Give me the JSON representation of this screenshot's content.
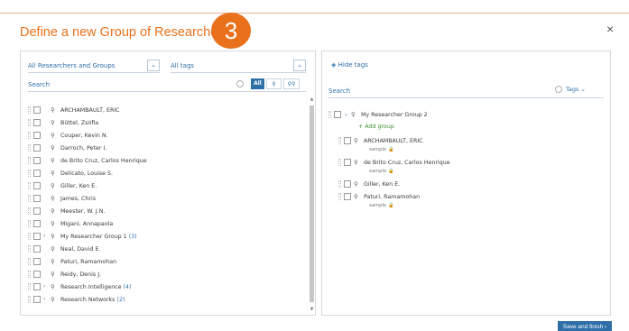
{
  "dialog": {
    "title": "Define a new Group of Researchers",
    "step_number": "3",
    "close_label": "×",
    "save_label": "Save and finish ›"
  },
  "left_panel": {
    "filter_dropdown": "All Researchers and Groups",
    "tags_dropdown": "All tags",
    "dropdown_arrow": "⌄",
    "search_placeholder": "Search",
    "segment_all": "All",
    "segment_person": "⚲",
    "segment_group": "⚲⚲",
    "rows": [
      {
        "label": "ARCHAMBAULT, ERIC",
        "expand": "",
        "count": ""
      },
      {
        "label": "Büttel, Zsófia",
        "expand": "",
        "count": ""
      },
      {
        "label": "Couper, Kevin N.",
        "expand": "",
        "count": ""
      },
      {
        "label": "Darroch, Peter I.",
        "expand": "",
        "count": ""
      },
      {
        "label": "de Brito Cruz, Carlos Henrique",
        "expand": "",
        "count": ""
      },
      {
        "label": "Delicato, Louise S.",
        "expand": "",
        "count": ""
      },
      {
        "label": "Giller, Ken E.",
        "expand": "",
        "count": ""
      },
      {
        "label": "James, Chris",
        "expand": "",
        "count": ""
      },
      {
        "label": "Meester, W. J.N.",
        "expand": "",
        "count": ""
      },
      {
        "label": "Migani, Annapaola",
        "expand": "",
        "count": ""
      },
      {
        "label": "My Researcher Group 1",
        "expand": "›",
        "count": "(3)"
      },
      {
        "label": "Neal, David E.",
        "expand": "",
        "count": ""
      },
      {
        "label": "Paturi, Ramamohan",
        "expand": "",
        "count": ""
      },
      {
        "label": "Reidy, Denis J.",
        "expand": "",
        "count": ""
      },
      {
        "label": "Research Intelligence",
        "expand": "›",
        "count": "(4)"
      },
      {
        "label": "Research Networks",
        "expand": "›",
        "count": "(2)"
      }
    ]
  },
  "right_panel": {
    "hide_tags_label": "Hide tags",
    "search_placeholder": "Search",
    "tags_label": "Tags ⌄",
    "group_name": "My Researcher Group 2",
    "add_group_label": "+ Add group",
    "members": [
      {
        "label": "ARCHAMBAULT, ERIC",
        "tag": "sample 🔒"
      },
      {
        "label": "de Brito Cruz, Carlos Henrique",
        "tag": "sample 🔒"
      },
      {
        "label": "Giller, Ken E.",
        "tag": ""
      },
      {
        "label": "Paturi, Ramamohan",
        "tag": "sample 🔒"
      }
    ]
  },
  "colors": {
    "accent_orange": "#e9711c",
    "link_blue": "#2e6fa8",
    "add_green": "#3a8f2e"
  }
}
